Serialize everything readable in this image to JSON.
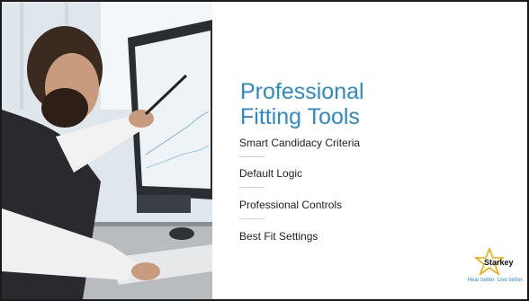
{
  "slide": {
    "title_line1": "Professional",
    "title_line2": "Fitting Tools",
    "items": [
      {
        "label": "Smart Candidacy Criteria"
      },
      {
        "label": "Default Logic"
      },
      {
        "label": "Professional Controls"
      },
      {
        "label": "Best Fit Settings"
      }
    ]
  },
  "logo": {
    "brand": "Starkey",
    "tagline": "Hear better. Live better."
  },
  "colors": {
    "title": "#2b8bc6",
    "text": "#222222",
    "accent_star": "#f2a900"
  }
}
